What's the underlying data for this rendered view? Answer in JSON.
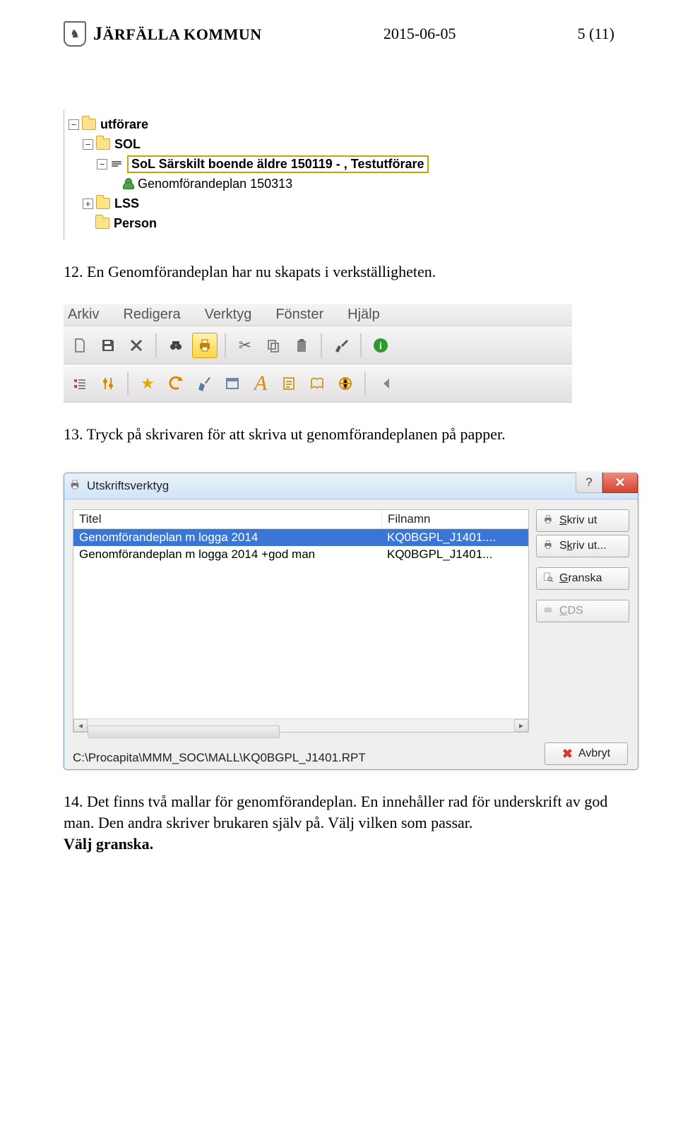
{
  "header": {
    "kommun_first": "J",
    "kommun_rest": "ÄRFÄLLA KOMMUN",
    "date": "2015-06-05",
    "page": "5 (11)"
  },
  "tree": {
    "utforare": "utförare",
    "sol": "SOL",
    "sol_sub": "SoL Särskilt boende äldre 150119 - , Testutförare",
    "plan": "Genomförandeplan 150313",
    "lss": "LSS",
    "person": "Person"
  },
  "text12": "12. En Genomförandeplan har nu skapats i verkställigheten.",
  "menu": {
    "arkiv": "Arkiv",
    "redigera": "Redigera",
    "verktyg": "Verktyg",
    "fonster": "Fönster",
    "hjalp": "Hjälp"
  },
  "text13": "13. Tryck på skrivaren för att skriva ut genomförandeplanen på papper.",
  "dialog": {
    "title": "Utskriftsverktyg",
    "col_titel": "Titel",
    "col_filnamn": "Filnamn",
    "rows": [
      {
        "titel": "Genomförandeplan m logga 2014",
        "filnamn": "KQ0BGPL_J1401...."
      },
      {
        "titel": "Genomförandeplan m logga 2014 +god man",
        "filnamn": "KQ0BGPL_J1401..."
      }
    ],
    "btn_skriv_ut": "Skriv ut",
    "btn_skriv_ut_dots": "Skriv ut...",
    "btn_granska": "Granska",
    "btn_cds": "CDS",
    "btn_avbryt": "Avbryt",
    "path": "C:\\Procapita\\MMM_SOC\\MALL\\KQ0BGPL_J1401.RPT"
  },
  "text14a": "14. Det finns två mallar för genomförandeplan. En innehåller rad för underskrift av god man. Den andra skriver brukaren själv på. Välj vilken som passar.",
  "text14b": "Välj granska."
}
